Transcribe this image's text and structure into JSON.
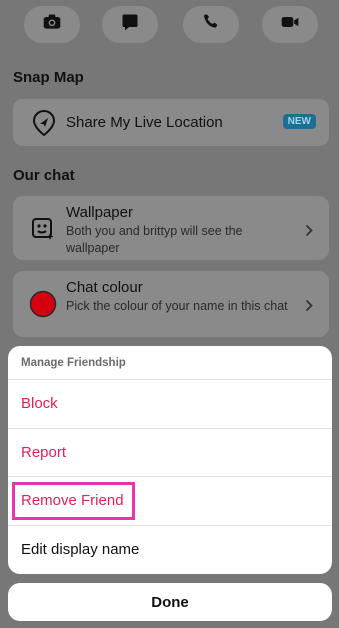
{
  "top_actions": {
    "icons": [
      "camera-icon",
      "chat-icon",
      "phone-icon",
      "video-icon"
    ]
  },
  "snap_map": {
    "heading": "Snap Map",
    "share_location_label": "Share My Live Location",
    "badge": "NEW",
    "badge_color": "#1b6f93"
  },
  "our_chat": {
    "heading": "Our chat",
    "wallpaper": {
      "title": "Wallpaper",
      "subtitle": "Both you and brittyp will see the wallpaper"
    },
    "chat_colour": {
      "title": "Chat colour",
      "subtitle": "Pick the colour of your name in this chat",
      "swatch_color": "#d4000f"
    }
  },
  "manage_sheet": {
    "header": "Manage Friendship",
    "items": [
      {
        "label": "Block",
        "style": "danger"
      },
      {
        "label": "Report",
        "style": "danger"
      },
      {
        "label": "Remove Friend",
        "style": "danger",
        "highlighted": true
      },
      {
        "label": "Edit display name",
        "style": "normal"
      }
    ],
    "danger_color": "#e0215a",
    "highlight_color": "#e636ab"
  },
  "done_button": {
    "label": "Done"
  }
}
